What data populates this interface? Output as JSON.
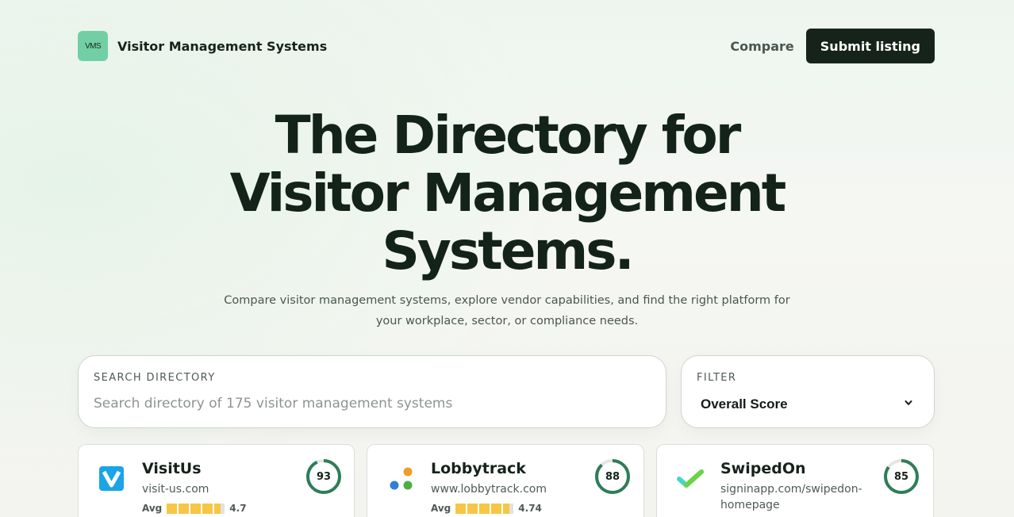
{
  "brand": {
    "logo_text": "VMS",
    "name": "Visitor Management Systems"
  },
  "nav": {
    "compare": "Compare",
    "submit": "Submit listing"
  },
  "hero": {
    "title_line1": "The Directory for",
    "title_line2": "Visitor Management",
    "title_line3": "Systems.",
    "subtitle": "Compare visitor management systems, explore vendor capabilities, and find the right platform for your workplace, sector, or compliance needs."
  },
  "search": {
    "label": "SEARCH DIRECTORY",
    "placeholder": "Search directory of 175 visitor management systems"
  },
  "filter": {
    "label": "FILTER",
    "value": "Overall Score"
  },
  "colors": {
    "accent": "#2e7d58",
    "dark": "#16231b",
    "star": "#f7c644",
    "brand_logo": "#72cfa5"
  },
  "cards": [
    {
      "name": "VisitUs",
      "url": "visit-us.com",
      "avg_label": "Avg",
      "rating": "4.7",
      "rating_value": 4.7,
      "score": "93",
      "score_value": 93,
      "icon": "visitus-v-logo"
    },
    {
      "name": "Lobbytrack",
      "url": "www.lobbytrack.com",
      "avg_label": "Avg",
      "rating": "4.74",
      "rating_value": 4.74,
      "score": "88",
      "score_value": 88,
      "icon": "lobbytrack-dots-logo"
    },
    {
      "name": "SwipedOn",
      "url": "signinapp.com/swipedon-homepage",
      "avg_label": "",
      "rating": "",
      "score": "85",
      "score_value": 85,
      "icon": "swipedon-check-logo"
    }
  ]
}
